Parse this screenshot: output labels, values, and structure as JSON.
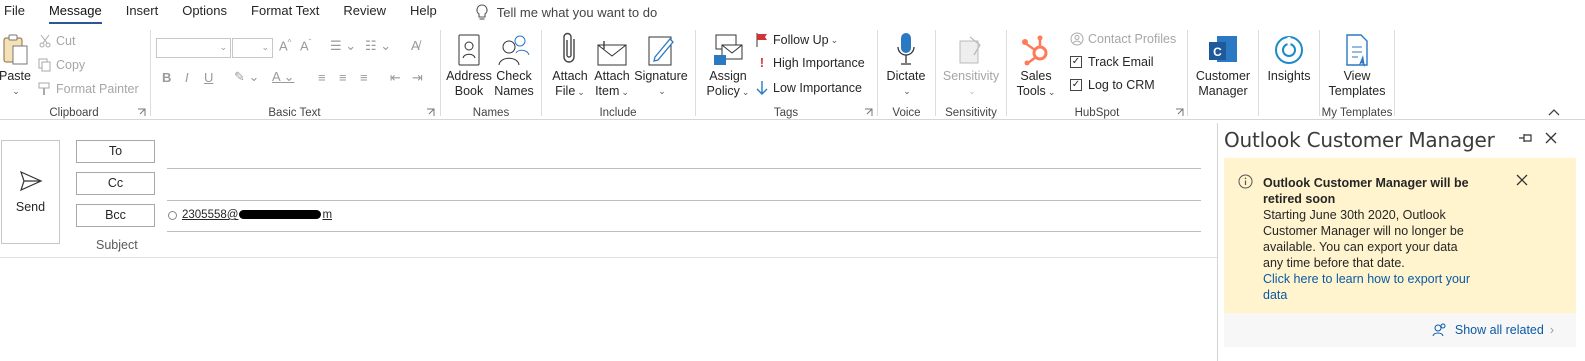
{
  "menu": {
    "tabs": [
      "File",
      "Message",
      "Insert",
      "Options",
      "Format Text",
      "Review",
      "Help"
    ],
    "active_tab": "Message",
    "tell_me": "Tell me what you want to do"
  },
  "ribbon": {
    "clipboard": {
      "label": "Clipboard",
      "paste": "Paste",
      "cut": "Cut",
      "copy": "Copy",
      "format_painter": "Format Painter"
    },
    "basic_text": {
      "label": "Basic Text"
    },
    "names": {
      "label": "Names",
      "address_book": [
        "Address",
        "Book"
      ],
      "check_names": [
        "Check",
        "Names"
      ]
    },
    "include": {
      "label": "Include",
      "attach_file": [
        "Attach",
        "File"
      ],
      "attach_item": [
        "Attach",
        "Item"
      ],
      "signature": "Signature"
    },
    "tags": {
      "label": "Tags",
      "assign_policy": [
        "Assign",
        "Policy"
      ],
      "follow_up": "Follow Up",
      "high_importance": "High Importance",
      "low_importance": "Low Importance"
    },
    "voice": {
      "label": "Voice",
      "dictate": "Dictate"
    },
    "sensitivity": {
      "label": "Sensitivity",
      "sensitivity_btn": "Sensitivity"
    },
    "hubspot": {
      "label": "HubSpot",
      "sales_tools": [
        "Sales",
        "Tools"
      ],
      "contact_profiles": "Contact Profiles",
      "track_email": "Track Email",
      "log_to_crm": "Log to CRM"
    },
    "customer_manager": [
      "Customer",
      "Manager"
    ],
    "insights": "Insights",
    "my_templates": {
      "label": "My Templates",
      "view_templates": [
        "View",
        "Templates"
      ]
    }
  },
  "compose": {
    "send": "Send",
    "to": "To",
    "cc": "Cc",
    "bcc": "Bcc",
    "subject": "Subject",
    "bcc_recipient_prefix": "2305558@",
    "bcc_recipient_suffix": "m"
  },
  "pane": {
    "title": "Outlook Customer Manager",
    "notice_title": "Outlook Customer Manager will be retired soon",
    "notice_body": "Starting June 30th 2020, Outlook Customer Manager will no longer be available. You can export your data any time before that date.",
    "notice_link": "Click here to learn how to export your data",
    "show_all": "Show all related"
  },
  "colors": {
    "accent": "#2b5797",
    "notice_bg": "#fff4ce",
    "link": "#0b5aa6",
    "hubspot_orange": "#ff7a59",
    "follow_up_red": "#d13438"
  }
}
